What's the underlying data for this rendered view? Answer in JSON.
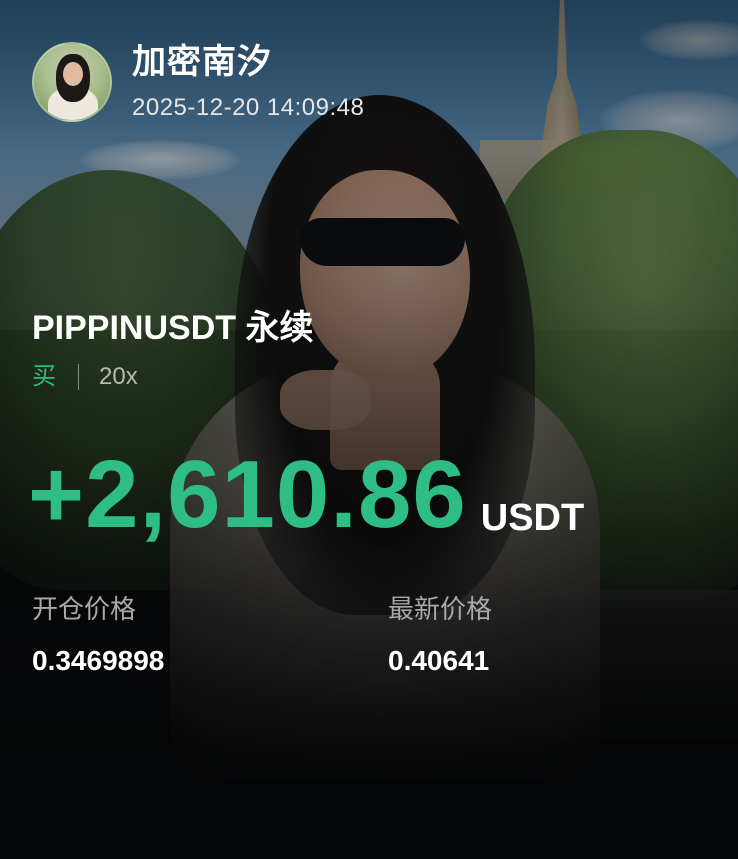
{
  "user": {
    "name": "加密南汐",
    "timestamp": "2025-12-20 14:09:48"
  },
  "position": {
    "pair": "PIPPINUSDT 永续",
    "side": "买",
    "leverage": "20x"
  },
  "pnl": {
    "value": "+2,610.86",
    "unit": "USDT"
  },
  "prices": {
    "entry_label": "开仓价格",
    "entry_value": "0.3469898",
    "latest_label": "最新价格",
    "latest_value": "0.40641"
  },
  "colors": {
    "profit_green": "#2ebd85",
    "text_white": "#ffffff",
    "label_gray": "#a9a9a9"
  },
  "icons": {
    "avatar": "user-avatar-photo"
  }
}
